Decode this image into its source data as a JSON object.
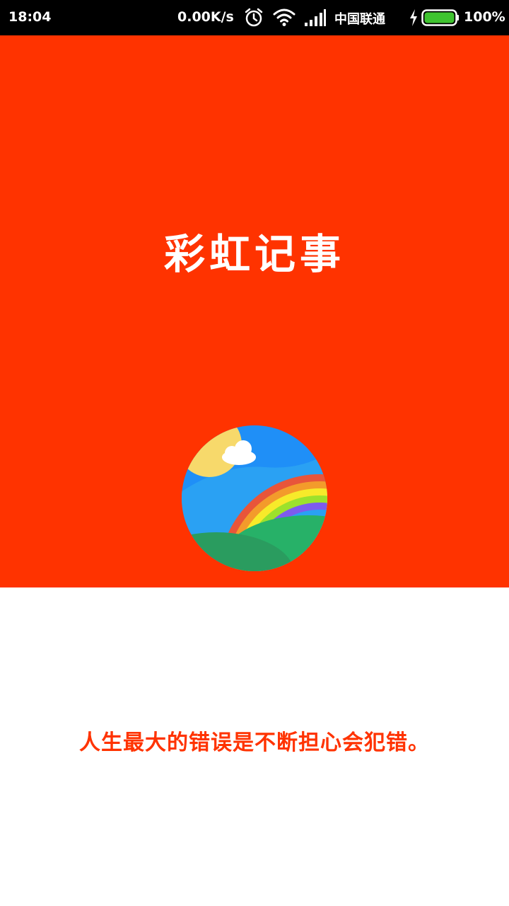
{
  "status_bar": {
    "time": "18:04",
    "network_speed": "0.00K/s",
    "carrier": "中国联通",
    "battery_percent": "100%",
    "battery_level": 1.0,
    "icons": [
      "alarm-icon",
      "wifi-icon",
      "signal-icon",
      "charging-icon",
      "battery-icon"
    ]
  },
  "splash": {
    "title": "彩虹记事",
    "quote": "人生最大的错误是不断担心会犯错。"
  },
  "colors": {
    "accent": "#ff3300",
    "title_text": "#ffffff",
    "quote_text": "#ff3300",
    "status_bar_bg": "#000000",
    "battery_fill": "#3fc32f"
  }
}
